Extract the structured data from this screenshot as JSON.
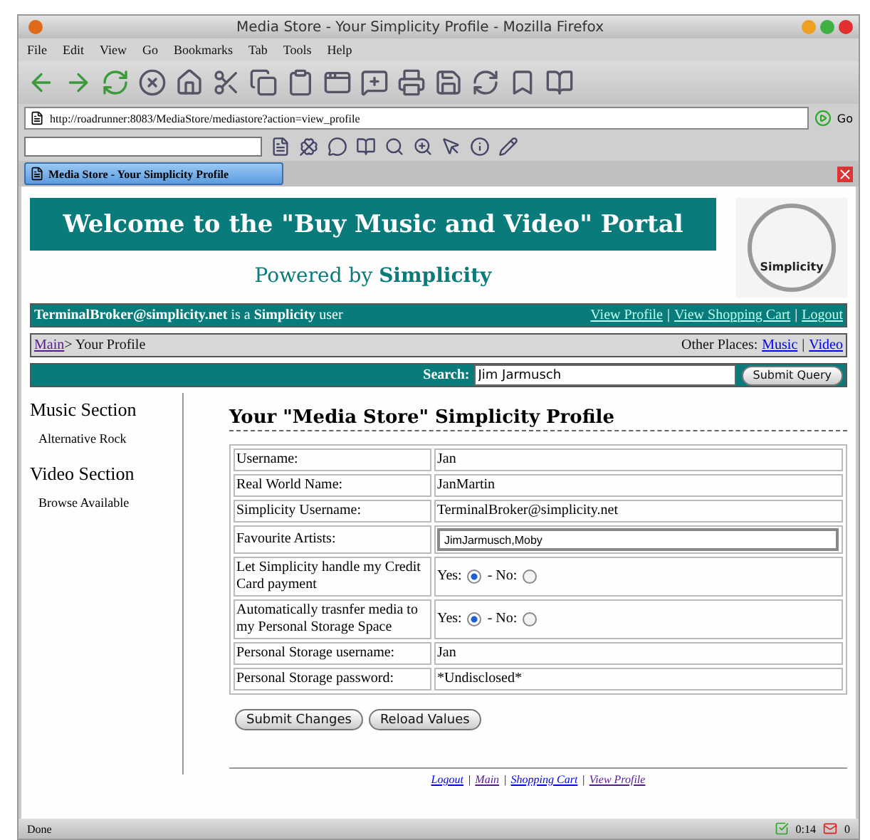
{
  "window": {
    "title": "Media Store - Your Simplicity Profile - Mozilla Firefox"
  },
  "menu": [
    "File",
    "Edit",
    "View",
    "Go",
    "Bookmarks",
    "Tab",
    "Tools",
    "Help"
  ],
  "address": {
    "value": "http://roadrunner:8083/MediaStore/mediastore?action=view_profile",
    "go": "Go"
  },
  "tab": {
    "title": "Media Store - Your Simplicity Profile"
  },
  "page": {
    "banner": "Welcome to the \"Buy Music and Video\" Portal",
    "powered_by": "Powered by **Simplicity**",
    "logo_text": "Simplicity",
    "user_bar": {
      "text": "**TerminalBroker@simplicity.net** is a **Simplicity** user",
      "links": [
        "View Profile",
        "View Shopping Cart",
        "Logout"
      ],
      "separator": "|"
    },
    "breadcrumb": {
      "link": "Main",
      "text": "> Your Profile",
      "other_label": "Other Places:",
      "links": [
        "Music",
        "Video"
      ],
      "separator": "|"
    },
    "search": {
      "label": "Search:",
      "value": "Jim Jarmusch",
      "button": "Submit Query"
    },
    "sidebar": [
      {
        "title": "Music Section",
        "items": [
          "Alternative Rock"
        ]
      },
      {
        "title": "Video Section",
        "items": [
          "Browse Available"
        ]
      }
    ],
    "heading": "Your \"Media Store\" Simplicity Profile",
    "rows": [
      {
        "kind": "text",
        "label": "Username:",
        "value": "Jan"
      },
      {
        "kind": "text",
        "label": "Real World Name:",
        "value": "JanMartin"
      },
      {
        "kind": "text",
        "label": "Simplicity Username:",
        "value": "TerminalBroker@simplicity.net"
      },
      {
        "kind": "input",
        "label": "Favourite Artists:",
        "value": "JimJarmusch,Moby"
      },
      {
        "kind": "radio",
        "label": "Let Simplicity handle my Credit Card payment",
        "options": [
          {
            "label": "Yes:",
            "selected": true
          },
          {
            "label": "- No:",
            "selected": false
          }
        ]
      },
      {
        "kind": "radio",
        "label": "Automatically trasnfer media to my Personal Storage Space",
        "options": [
          {
            "label": "Yes:",
            "selected": true
          },
          {
            "label": "- No:",
            "selected": false
          }
        ]
      },
      {
        "kind": "text",
        "label": "Personal Storage username:",
        "value": "Jan"
      },
      {
        "kind": "text",
        "label": "Personal Storage password:",
        "value": "*Undisclosed*"
      }
    ],
    "buttons": [
      "Submit Changes",
      "Reload Values"
    ],
    "footer_links": [
      "Logout",
      "Main",
      "Shopping Cart",
      "View Profile"
    ],
    "footer_separator": "|"
  },
  "status": {
    "text": "Done",
    "time": "0:14",
    "mail": "0"
  }
}
